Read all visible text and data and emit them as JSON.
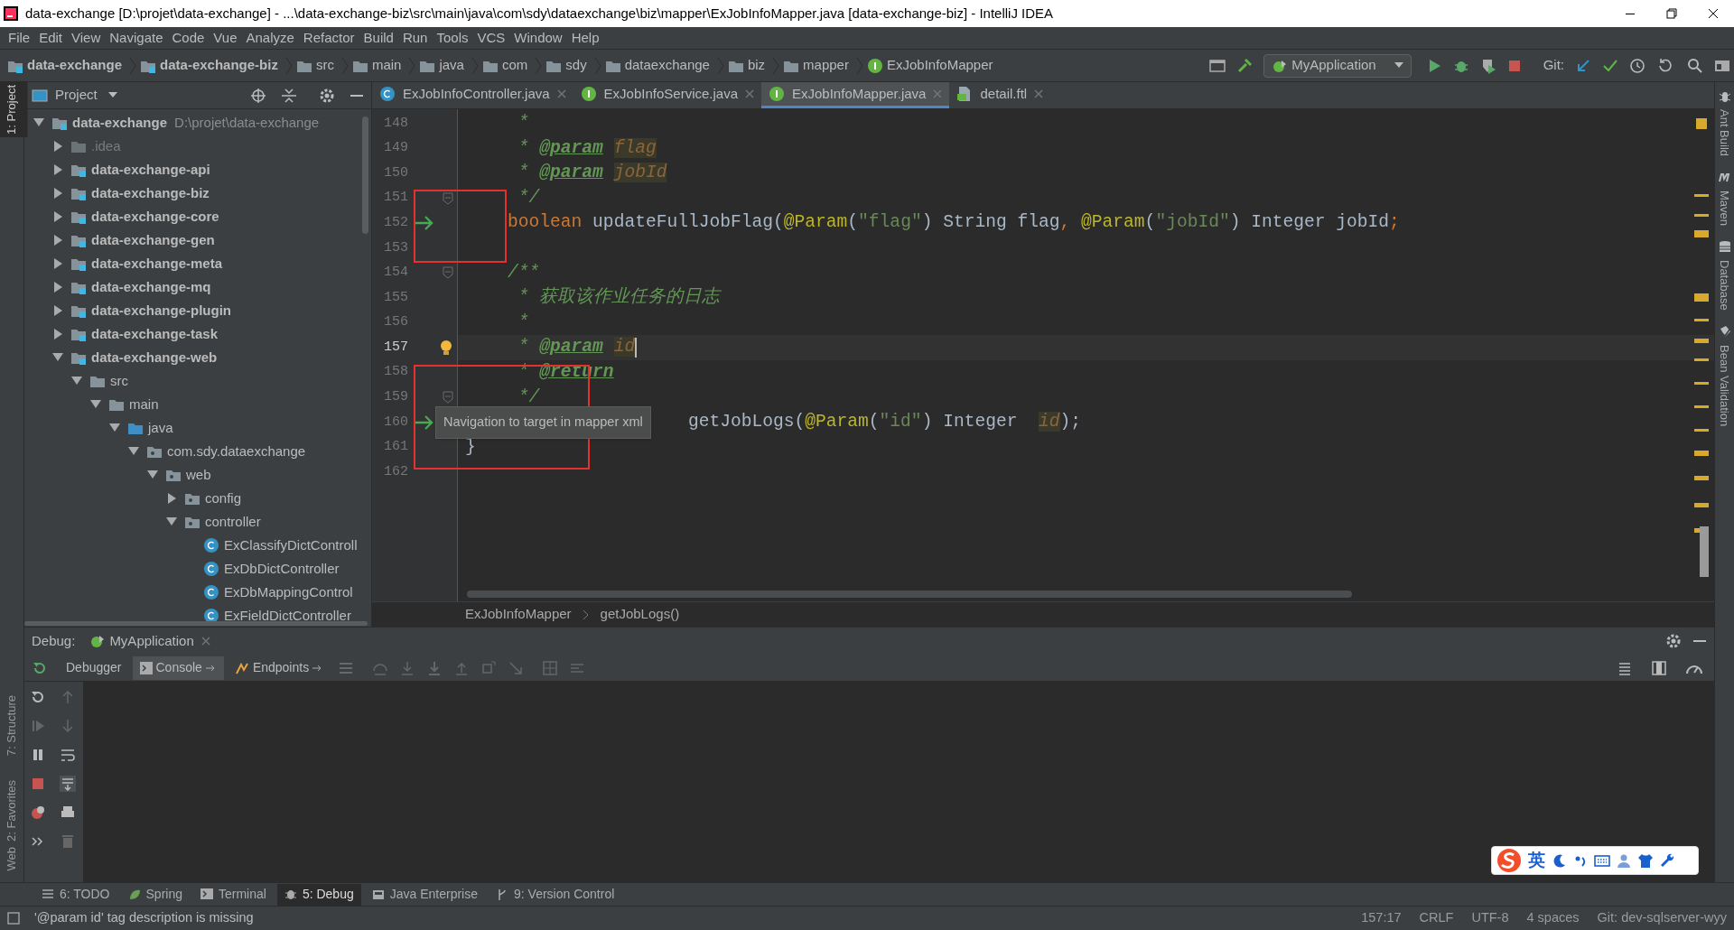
{
  "window": {
    "title": "data-exchange [D:\\projet\\data-exchange] - ...\\data-exchange-biz\\src\\main\\java\\com\\sdy\\dataexchange\\biz\\mapper\\ExJobInfoMapper.java [data-exchange-biz] - IntelliJ IDEA"
  },
  "menu": [
    "File",
    "Edit",
    "View",
    "Navigate",
    "Code",
    "Vue",
    "Analyze",
    "Refactor",
    "Build",
    "Run",
    "Tools",
    "VCS",
    "Window",
    "Help"
  ],
  "nav": {
    "breadcrumbs": [
      {
        "kind": "module",
        "label": "data-exchange"
      },
      {
        "kind": "module",
        "label": "data-exchange-biz"
      },
      {
        "kind": "folder",
        "label": "src"
      },
      {
        "kind": "folder",
        "label": "main"
      },
      {
        "kind": "folder",
        "label": "java"
      },
      {
        "kind": "folder",
        "label": "com"
      },
      {
        "kind": "folder",
        "label": "sdy"
      },
      {
        "kind": "folder",
        "label": "dataexchange"
      },
      {
        "kind": "folder",
        "label": "biz"
      },
      {
        "kind": "folder",
        "label": "mapper"
      },
      {
        "kind": "interface",
        "label": "ExJobInfoMapper"
      }
    ],
    "run_config": "MyApplication",
    "git_label": "Git:"
  },
  "left_tools": [
    {
      "label": "1: Project",
      "selected": true
    },
    {
      "label": "7: Structure",
      "selected": false
    },
    {
      "label": "2: Favorites",
      "selected": false
    },
    {
      "label": "Web",
      "selected": false
    }
  ],
  "right_tools": [
    "Ant Build",
    "Maven",
    "Database",
    "Bean Validation"
  ],
  "project_panel": {
    "title": "Project",
    "tree": [
      {
        "kind": "module",
        "label": "data-exchange",
        "path": "D:\\projet\\data-exchange",
        "expanded": true,
        "children": [
          {
            "kind": "excluded",
            "label": ".idea",
            "expanded": false
          },
          {
            "kind": "module",
            "label": "data-exchange-api",
            "expanded": false
          },
          {
            "kind": "module",
            "label": "data-exchange-biz",
            "expanded": false
          },
          {
            "kind": "module",
            "label": "data-exchange-core",
            "expanded": false
          },
          {
            "kind": "module",
            "label": "data-exchange-gen",
            "expanded": false
          },
          {
            "kind": "module",
            "label": "data-exchange-meta",
            "expanded": false
          },
          {
            "kind": "module",
            "label": "data-exchange-mq",
            "expanded": false
          },
          {
            "kind": "module",
            "label": "data-exchange-plugin",
            "expanded": false
          },
          {
            "kind": "module",
            "label": "data-exchange-task",
            "expanded": false
          },
          {
            "kind": "module",
            "label": "data-exchange-web",
            "expanded": true,
            "children": [
              {
                "kind": "folder",
                "label": "src",
                "expanded": true,
                "children": [
                  {
                    "kind": "folder",
                    "label": "main",
                    "expanded": true,
                    "children": [
                      {
                        "kind": "source",
                        "label": "java",
                        "expanded": true,
                        "children": [
                          {
                            "kind": "package",
                            "label": "com.sdy.dataexchange",
                            "expanded": true,
                            "children": [
                              {
                                "kind": "package",
                                "label": "web",
                                "expanded": true,
                                "children": [
                                  {
                                    "kind": "package",
                                    "label": "config",
                                    "expanded": false
                                  },
                                  {
                                    "kind": "package",
                                    "label": "controller",
                                    "expanded": true,
                                    "children": [
                                      {
                                        "kind": "class",
                                        "label": "ExClassifyDictControll"
                                      },
                                      {
                                        "kind": "class",
                                        "label": "ExDbDictController"
                                      },
                                      {
                                        "kind": "class",
                                        "label": "ExDbMappingControl"
                                      },
                                      {
                                        "kind": "class",
                                        "label": "ExFieldDictController"
                                      }
                                    ]
                                  }
                                ]
                              }
                            ]
                          }
                        ]
                      }
                    ]
                  }
                ]
              }
            ]
          }
        ]
      }
    ]
  },
  "editor_tabs": [
    {
      "kind": "class",
      "label": "ExJobInfoController.java",
      "selected": false
    },
    {
      "kind": "interface",
      "label": "ExJobInfoService.java",
      "selected": false
    },
    {
      "kind": "interface",
      "label": "ExJobInfoMapper.java",
      "selected": true
    },
    {
      "kind": "template",
      "label": "detail.ftl",
      "selected": false
    }
  ],
  "editor": {
    "lines": [
      {
        "number": "148",
        "current": false,
        "tokens": [
          {
            "kind": "comment",
            "text": "     *"
          }
        ]
      },
      {
        "number": "149",
        "current": false,
        "tokens": [
          {
            "kind": "comment",
            "text": "     * "
          },
          {
            "kind": "doctag",
            "text": "@param"
          },
          {
            "kind": "paramref",
            "text": "flag"
          }
        ]
      },
      {
        "number": "150",
        "current": false,
        "tokens": [
          {
            "kind": "comment",
            "text": "     * "
          },
          {
            "kind": "doctag",
            "text": "@param"
          },
          {
            "kind": "paramref",
            "text": "jobId"
          }
        ]
      },
      {
        "number": "151",
        "current": false,
        "gutter": {
          "kind": "fold"
        },
        "tokens": [
          {
            "kind": "comment",
            "text": "     */"
          }
        ]
      },
      {
        "number": "152",
        "current": false,
        "gutter": {
          "kind": "arrow"
        },
        "tokens": [
          {
            "kind": "keyword",
            "text": "    boolean "
          },
          {
            "kind": "plain",
            "text": "updateFullJobFlag("
          },
          {
            "kind": "annotation",
            "text": "@Param"
          },
          {
            "kind": "plain",
            "text": "("
          },
          {
            "kind": "string",
            "text": "\"flag\""
          },
          {
            "kind": "plain",
            "text": ") String flag"
          },
          {
            "kind": "keyword",
            "text": ", "
          },
          {
            "kind": "annotation",
            "text": "@Param"
          },
          {
            "kind": "plain",
            "text": "("
          },
          {
            "kind": "string",
            "text": "\"jobId\""
          },
          {
            "kind": "plain",
            "text": ") Integer jobId"
          },
          {
            "kind": "keyword",
            "text": ";"
          }
        ]
      },
      {
        "number": "153",
        "current": false
      },
      {
        "number": "154",
        "current": false,
        "gutter": {
          "kind": "fold"
        },
        "tokens": [
          {
            "kind": "comment",
            "text": "    /**"
          }
        ]
      },
      {
        "number": "155",
        "current": false,
        "tokens": [
          {
            "kind": "comment",
            "text": "     * 获取该作业任务的日志"
          }
        ]
      },
      {
        "number": "156",
        "current": false,
        "tokens": [
          {
            "kind": "comment",
            "text": "     *"
          }
        ]
      },
      {
        "number": "157",
        "current": true,
        "gutter": {
          "kind": "bulb"
        },
        "tokens": [
          {
            "kind": "comment",
            "text": "     * "
          },
          {
            "kind": "doctag",
            "text": "@param"
          },
          {
            "kind": "paramref",
            "text": "id"
          }
        ]
      },
      {
        "number": "158",
        "current": false,
        "tokens": [
          {
            "kind": "comment",
            "text": "     * "
          },
          {
            "kind": "doctag",
            "text": "@return"
          }
        ]
      },
      {
        "number": "159",
        "current": false,
        "gutter": {
          "kind": "fold"
        },
        "tokens": [
          {
            "kind": "comment",
            "text": "     */"
          }
        ]
      },
      {
        "number": "160",
        "current": false,
        "gutter": {
          "kind": "arrow"
        },
        "tokens": [
          {
            "kind": "plain",
            "text": "                     getJobLogs("
          },
          {
            "kind": "annotation",
            "text": "@Param"
          },
          {
            "kind": "plain",
            "text": "("
          },
          {
            "kind": "string",
            "text": "\"id\""
          },
          {
            "kind": "plain",
            "text": ") Integer "
          },
          {
            "kind": "paramref",
            "text": "id"
          },
          {
            "kind": "plain",
            "text": ");"
          }
        ]
      },
      {
        "number": "161",
        "current": false,
        "tokens": [
          {
            "kind": "plain",
            "text": "}"
          }
        ]
      },
      {
        "number": "162",
        "current": false
      }
    ],
    "tooltip": "Navigation to target in mapper xml",
    "breadcrumbs": [
      "ExJobInfoMapper",
      "getJobLogs()"
    ]
  },
  "debug": {
    "label": "Debug:",
    "config": "MyApplication",
    "tabs": [
      {
        "label": "Debugger",
        "selected": false
      },
      {
        "label": "Console",
        "selected": true
      },
      {
        "label": "Endpoints",
        "selected": false
      }
    ]
  },
  "bottom_tools": [
    {
      "label": "6: TODO",
      "selected": false
    },
    {
      "label": "Spring",
      "selected": false
    },
    {
      "label": "Terminal",
      "selected": false
    },
    {
      "label": "5: Debug",
      "selected": true
    },
    {
      "label": "Java Enterprise",
      "selected": false
    },
    {
      "label": "9: Version Control",
      "selected": false
    }
  ],
  "ime": {
    "mode": "英"
  },
  "status": {
    "message": "'@param id' tag description is missing",
    "items": [
      "157:17",
      "CRLF",
      "UTF-8",
      "4 spaces",
      "Git: dev-sqlserver-wyy"
    ]
  }
}
